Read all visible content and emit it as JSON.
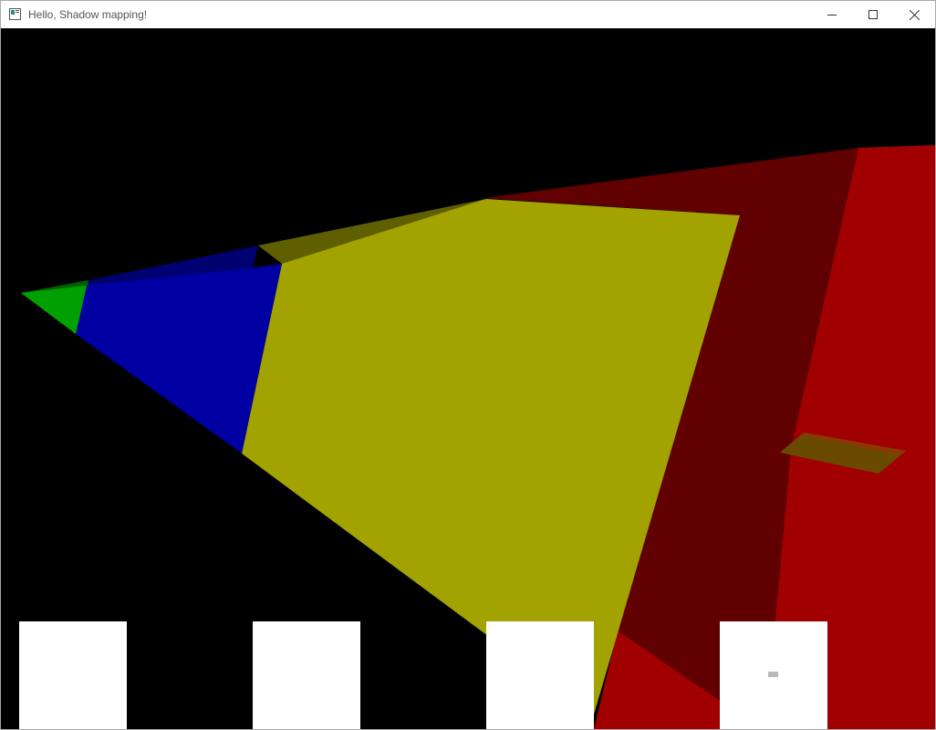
{
  "window": {
    "title": "Hello, Shadow mapping!",
    "icon": "app-window-icon",
    "controls": [
      "minimize-icon",
      "maximize-icon",
      "close-icon"
    ]
  },
  "scene": {
    "background": "#000000",
    "surfaces": [
      {
        "name": "green-cascade",
        "color": "#00a000"
      },
      {
        "name": "blue-cascade",
        "color": "#0000a2"
      },
      {
        "name": "yellow-cascade",
        "color": "#a2a200"
      },
      {
        "name": "red-cascade",
        "color": "#a00000"
      }
    ],
    "object": {
      "name": "floating-plane-object",
      "color": "#6a4a00"
    }
  },
  "shadow_map_previews": {
    "count": 4,
    "color": "#ffffff"
  }
}
